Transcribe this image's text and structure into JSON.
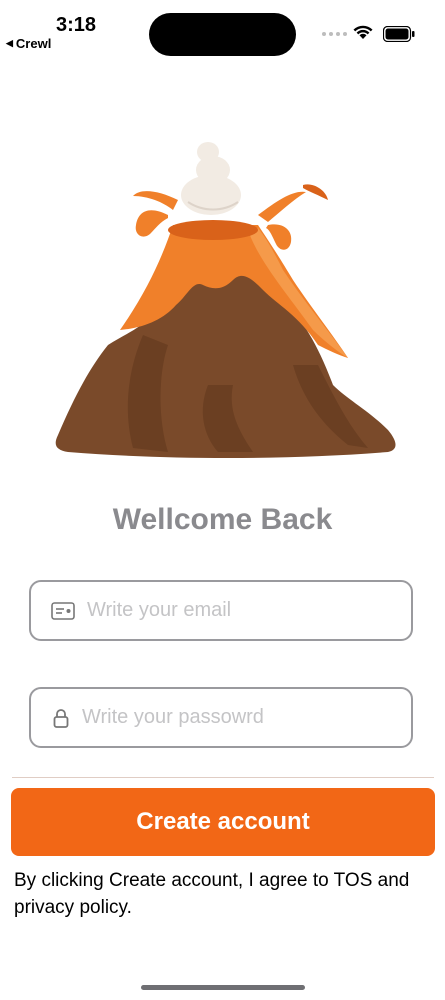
{
  "status_bar": {
    "time": "3:18",
    "back_app": "Crewl",
    "back_glyph": "◀"
  },
  "illustration": {
    "name": "volcano"
  },
  "login": {
    "title": "Wellcome Back",
    "email_placeholder": "Write your email",
    "password_placeholder": "Write your passowrd",
    "create_button": "Create account",
    "terms_text": "By clicking Create account, I agree to TOS and privacy policy."
  },
  "colors": {
    "accent": "#f26716",
    "title": "#8a8a8e",
    "field_border": "#9a9a9e",
    "volcano_brown": "#7a4a2a",
    "lava": "#f0802a"
  }
}
